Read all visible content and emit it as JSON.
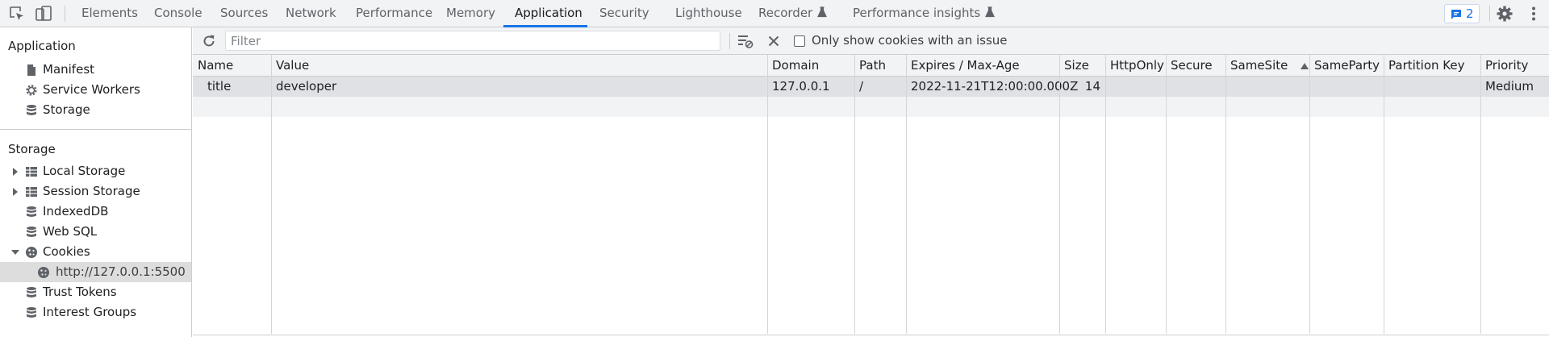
{
  "topbar": {
    "tabs": [
      {
        "label": "Elements"
      },
      {
        "label": "Console"
      },
      {
        "label": "Sources"
      },
      {
        "label": "Network"
      },
      {
        "label": "Performance"
      },
      {
        "label": "Memory"
      },
      {
        "label": "Application"
      },
      {
        "label": "Security"
      },
      {
        "label": "Lighthouse"
      },
      {
        "label": "Recorder"
      },
      {
        "label": "Performance insights"
      }
    ],
    "active_tab": "Application",
    "issues_count": "2",
    "accent_color": "#1a73e8"
  },
  "sidebar": {
    "application_heading": "Application",
    "application_items": [
      {
        "label": "Manifest",
        "icon": "document-icon"
      },
      {
        "label": "Service Workers",
        "icon": "gear-icon"
      },
      {
        "label": "Storage",
        "icon": "database-icon"
      }
    ],
    "storage_heading": "Storage",
    "storage_items": [
      {
        "label": "Local Storage",
        "icon": "grid-icon",
        "expand": "collapsed"
      },
      {
        "label": "Session Storage",
        "icon": "grid-icon",
        "expand": "collapsed"
      },
      {
        "label": "IndexedDB",
        "icon": "database-icon"
      },
      {
        "label": "Web SQL",
        "icon": "database-icon"
      },
      {
        "label": "Cookies",
        "icon": "cookie-icon",
        "expand": "expanded"
      },
      {
        "label": "http://127.0.0.1:5500",
        "icon": "cookie-icon",
        "selected": true
      },
      {
        "label": "Trust Tokens",
        "icon": "database-icon"
      },
      {
        "label": "Interest Groups",
        "icon": "database-icon"
      }
    ]
  },
  "toolbar": {
    "filter_placeholder": "Filter",
    "only_issues_label": "Only show cookies with an issue",
    "only_issues_checked": false
  },
  "cookies_table": {
    "columns": [
      "Name",
      "Value",
      "Domain",
      "Path",
      "Expires / Max-Age",
      "Size",
      "HttpOnly",
      "Secure",
      "SameSite",
      "SameParty",
      "Partition Key",
      "Priority"
    ],
    "sorted_column": "SameSite",
    "sort_direction": "ascending",
    "rows": [
      {
        "name": "title",
        "value": "developer",
        "domain": "127.0.0.1",
        "path": "/",
        "expires": "2022-11-21T12:00:00.000Z",
        "size": "14",
        "httponly": "",
        "secure": "",
        "samesite": "",
        "sameparty": "",
        "partition_key": "",
        "priority": "Medium"
      }
    ]
  }
}
